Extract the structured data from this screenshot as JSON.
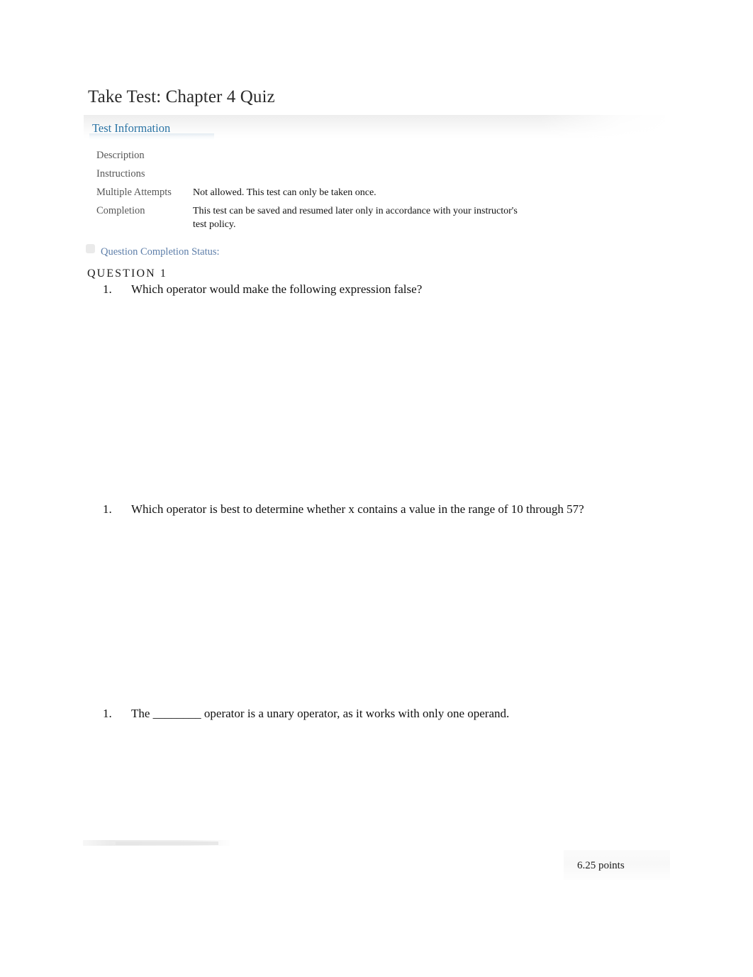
{
  "page": {
    "title": "Take Test: Chapter 4 Quiz"
  },
  "test_information": {
    "section_header": "Test Information",
    "rows": [
      {
        "label": "Description",
        "value": ""
      },
      {
        "label": "Instructions",
        "value": ""
      },
      {
        "label": "Multiple Attempts",
        "value": "Not allowed. This test can only be taken once."
      },
      {
        "label": "Completion",
        "value": "This test can be saved and resumed later only in accordance with your instructor's test policy."
      }
    ]
  },
  "question_completion_status": {
    "label": "Question Completion Status:",
    "icon": "status-panel-icon"
  },
  "question_section": {
    "header": "QUESTION 1",
    "items": [
      {
        "number": "1.",
        "text": "Which operator would make the following expression false?"
      },
      {
        "number": "1.",
        "text": "Which operator is best to determine whether x contains a value in the range of 10 through 57?"
      },
      {
        "number": "1.",
        "text": "The ________ operator is a unary operator, as it works with only one operand."
      }
    ],
    "points": "6.25 points"
  },
  "colors": {
    "section_header_blue": "#2b74a5",
    "status_blue": "#5d7ea9",
    "label_gray": "#575757",
    "body_black": "#111111"
  }
}
